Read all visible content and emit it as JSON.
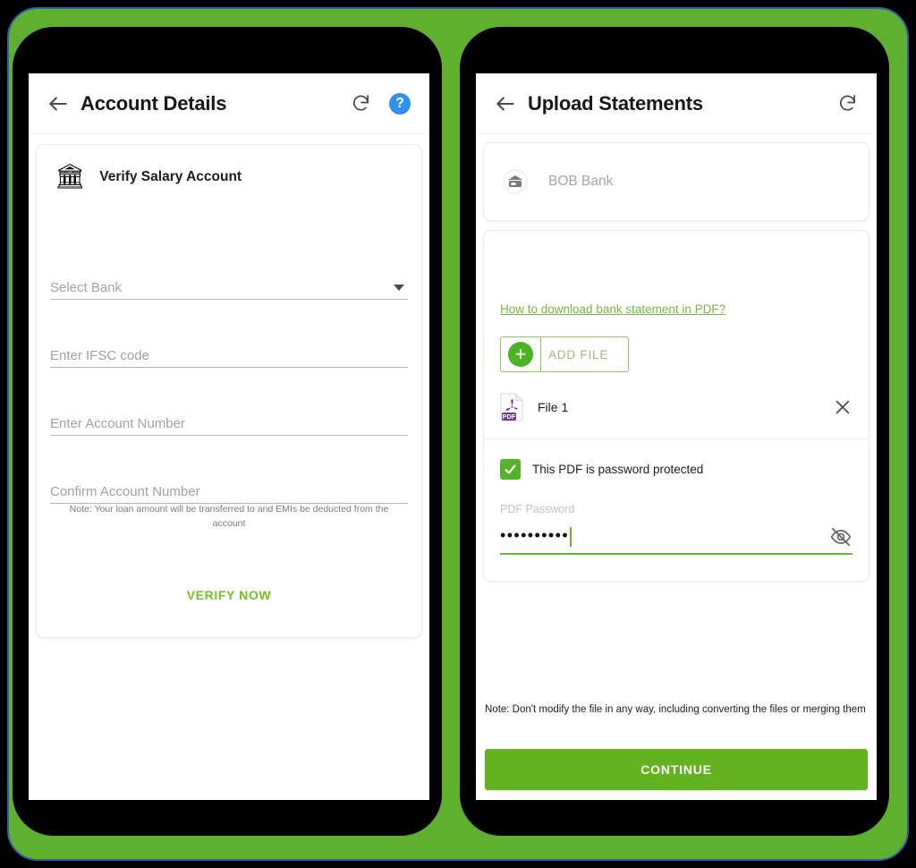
{
  "theme": {
    "frame_green": "#5fb02f",
    "frame_outline_blue": "#2f5fa8",
    "accent_green": "#63b220",
    "link_green": "#76b83f",
    "checkbox_green": "#55b32a",
    "help_blue": "#2f8ff5",
    "phone_bezel": "#000000"
  },
  "left_phone": {
    "appbar": {
      "back_icon": "back-arrow-icon",
      "title": "Account Details",
      "refresh_icon": "refresh-icon",
      "help_icon": "help-icon",
      "help_label": "?"
    },
    "verify_card": {
      "bank_icon": "classical-bank-icon",
      "title": "Verify Salary Account",
      "fields": [
        {
          "name": "select-bank",
          "placeholder": "Select Bank",
          "value": "",
          "type": "dropdown"
        },
        {
          "name": "ifsc-code",
          "placeholder": "Enter IFSC code",
          "value": "",
          "type": "text"
        },
        {
          "name": "account-number",
          "placeholder": "Enter Account Number",
          "value": "",
          "type": "text"
        },
        {
          "name": "confirm-account-number",
          "placeholder": "Confirm Account Number",
          "value": "",
          "type": "text"
        }
      ],
      "note": "Note: Your loan amount will be transferred to and EMIs be deducted from the account",
      "verify_button": "VERIFY NOW"
    }
  },
  "right_phone": {
    "appbar": {
      "back_icon": "back-arrow-icon",
      "title": "Upload Statements",
      "refresh_icon": "refresh-icon"
    },
    "bank_row": {
      "icon": "bank-building-icon",
      "name": "BOB Bank"
    },
    "upload_card": {
      "howto_link": "How to download bank statement in PDF?",
      "add_file_button": "ADD FILE",
      "add_file_icon": "plus-circle-icon",
      "files": [
        {
          "icon": "pdf-file-icon",
          "name": "File 1",
          "remove_icon": "close-icon"
        }
      ],
      "password_protected_checkbox": {
        "checked": true,
        "label": "This PDF is password protected"
      },
      "password_field": {
        "label": "PDF Password",
        "value": "••••••••••",
        "masked_length": 10,
        "toggle_icon": "eye-off-icon"
      }
    },
    "bottom_note": "Note: Don't modify the file in any way, including converting the files or merging them",
    "continue_button": "CONTINUE"
  }
}
